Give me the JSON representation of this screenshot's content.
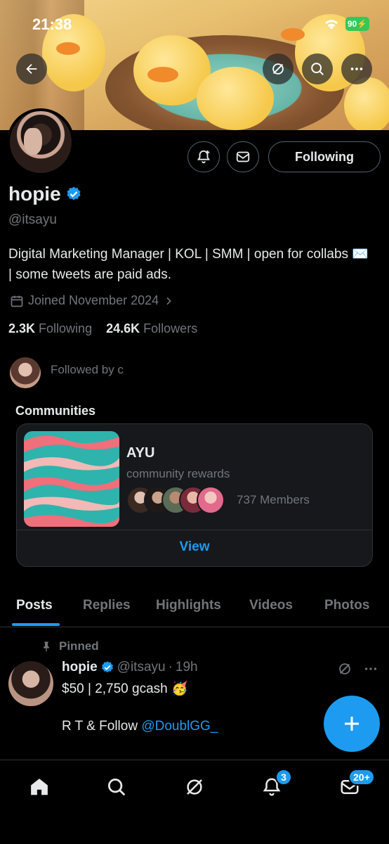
{
  "status_bar": {
    "time": "21:38",
    "battery": "90"
  },
  "profile": {
    "name": "hopie",
    "handle": "@itsayu",
    "bio": "Digital Marketing Manager | KOL | SMM | open for collabs ✉️ | some tweets are paid ads.",
    "joined": "Joined November 2024",
    "following_count": "2.3K",
    "following_label": "Following",
    "followers_count": "24.6K",
    "followers_label": "Followers",
    "followed_by": "Followed by c",
    "follow_button": "Following"
  },
  "communities": {
    "title": "Communities",
    "name": "AYU",
    "description": "community rewards",
    "members": "737 Members",
    "view_label": "View"
  },
  "tabs": [
    "Posts",
    "Replies",
    "Highlights",
    "Videos",
    "Photos"
  ],
  "post": {
    "pinned_label": "Pinned",
    "author": "hopie",
    "handle": "@itsayu",
    "time": "19h",
    "line1": "$50 | 2,750 gcash 🥳",
    "line2_prefix": "R T & Follow",
    "line2_mention": "@DoublGG_"
  },
  "bottom_nav": {
    "notifications_badge": "3",
    "messages_badge": "20+"
  },
  "colors": {
    "accent": "#1d9bf0",
    "background": "#000000",
    "muted": "#71767b"
  }
}
